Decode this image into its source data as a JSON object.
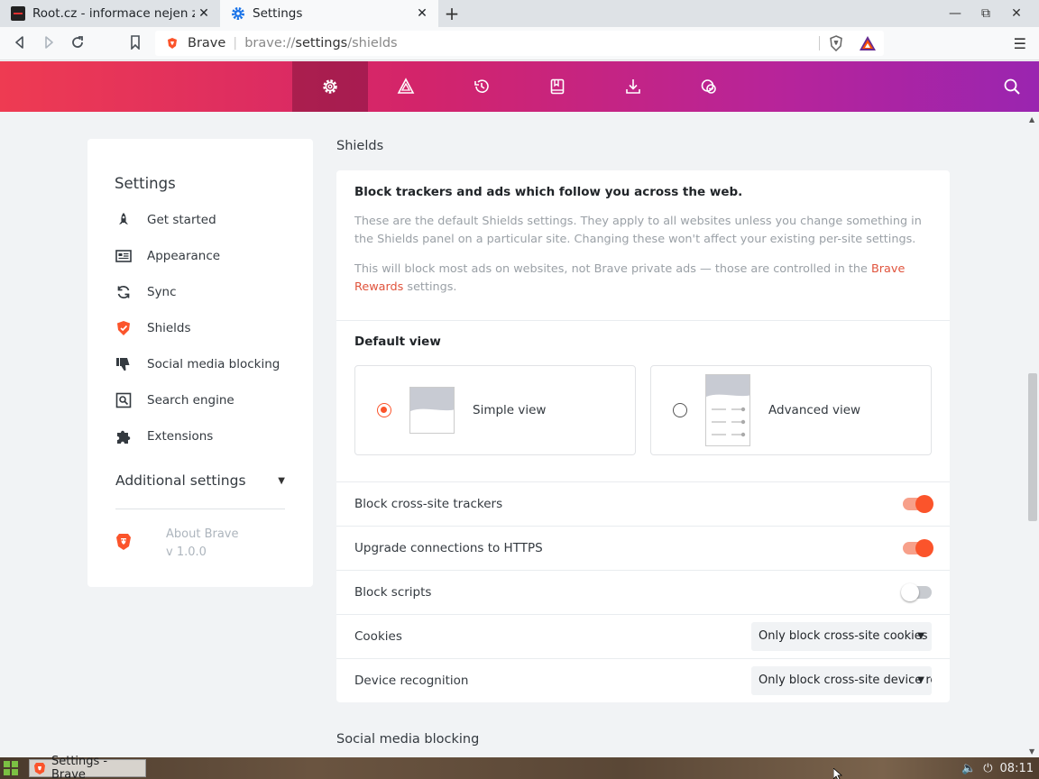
{
  "browser": {
    "tabs": [
      {
        "title": "Root.cz - informace nejen ze světa Linuxu",
        "active": false
      },
      {
        "title": "Settings",
        "active": true
      }
    ],
    "address_site": "Brave",
    "address_url_prefix": "brave://",
    "address_url_host": "settings",
    "address_url_path": "/shields"
  },
  "header": {
    "items": [
      "settings-icon",
      "rewards-icon",
      "history-icon",
      "bookmarks-icon",
      "downloads-icon",
      "wallet-icon"
    ],
    "active_index": 0
  },
  "sidebar": {
    "title": "Settings",
    "items": [
      {
        "label": "Get started",
        "icon": "rocket-icon"
      },
      {
        "label": "Appearance",
        "icon": "appearance-icon"
      },
      {
        "label": "Sync",
        "icon": "sync-icon"
      },
      {
        "label": "Shields",
        "icon": "shield-icon"
      },
      {
        "label": "Social media blocking",
        "icon": "thumbs-down-icon"
      },
      {
        "label": "Search engine",
        "icon": "search-engine-icon"
      },
      {
        "label": "Extensions",
        "icon": "puzzle-icon"
      }
    ],
    "additional_settings": "Additional settings",
    "about_label": "About Brave",
    "version": "v 1.0.0"
  },
  "main": {
    "section_title": "Shields",
    "heading": "Block trackers and ads which follow you across the web.",
    "para1": "These are the default Shields settings. They apply to all websites unless you change something in the Shields panel on a particular site. Changing these won't affect your existing per-site settings.",
    "para2_before": "This will block most ads on websites, not Brave private ads — those are controlled in the ",
    "para2_link": "Brave Rewards",
    "para2_after": " settings.",
    "default_view_label": "Default view",
    "simple_view": "Simple view",
    "advanced_view": "Advanced view",
    "selected_view": "Simple view",
    "rows": [
      {
        "label": "Block cross-site trackers",
        "toggle": true
      },
      {
        "label": "Upgrade connections to HTTPS",
        "toggle": true
      },
      {
        "label": "Block scripts",
        "toggle": false
      },
      {
        "label": "Cookies",
        "select": "Only block cross-site cookies"
      },
      {
        "label": "Device recognition",
        "select": "Only block cross-site device recognition"
      }
    ],
    "next_section_title": "Social media blocking"
  },
  "taskbar": {
    "task_label": "Settings - Brave",
    "clock": "08:11"
  },
  "colors": {
    "accent": "#fb542b",
    "header_start": "#ee3b52",
    "header_end": "#9a25b0"
  }
}
